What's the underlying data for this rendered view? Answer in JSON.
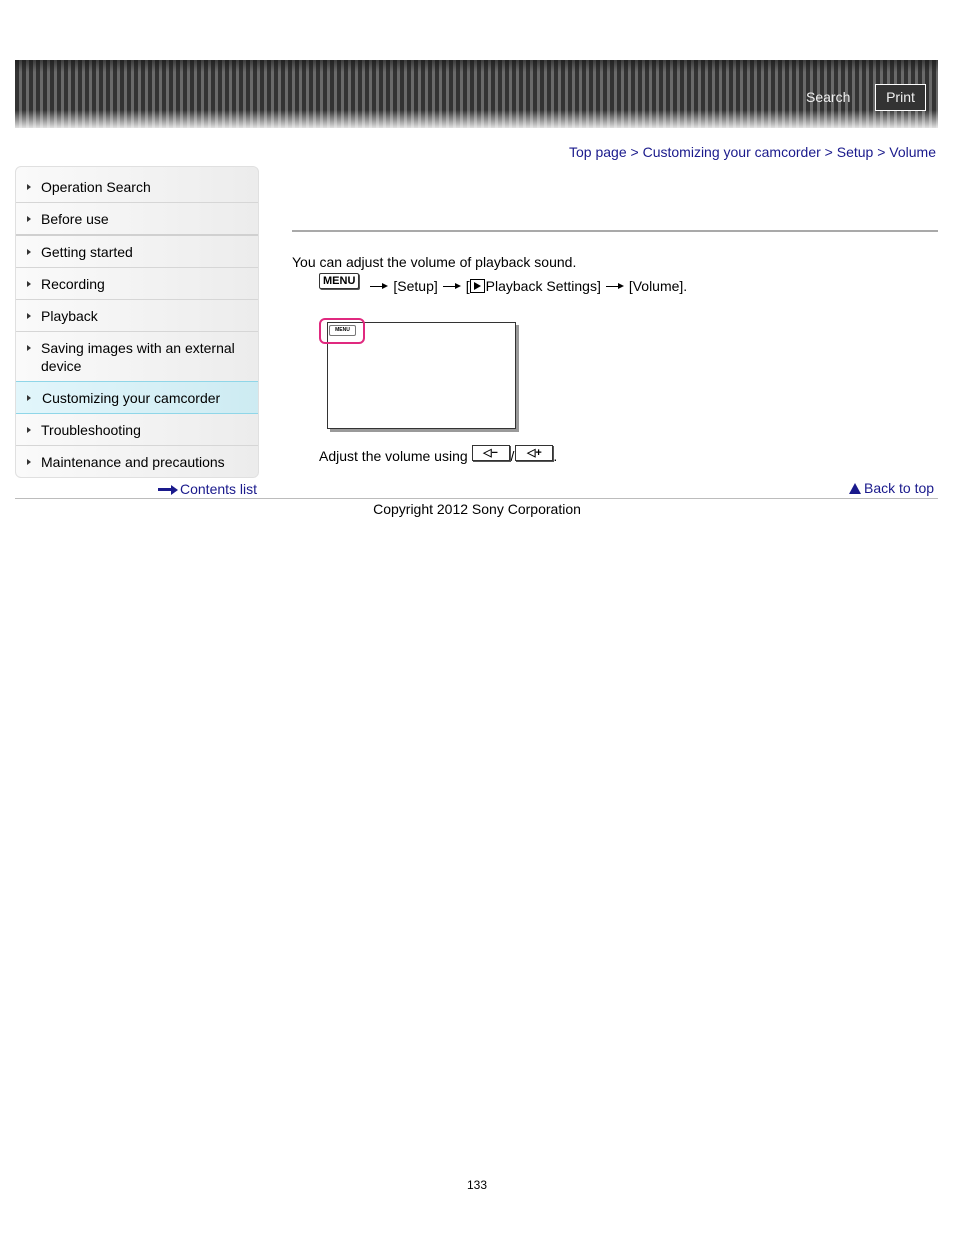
{
  "header": {
    "search_label": "Search",
    "print_label": "Print"
  },
  "breadcrumb": {
    "items": [
      "Top page",
      "Customizing your camcorder",
      "Setup",
      "Volume"
    ],
    "separator": ">"
  },
  "sidebar": {
    "items": [
      {
        "label": "Operation Search",
        "active": false
      },
      {
        "label": "Before use",
        "active": false
      },
      {
        "label": "Getting started",
        "active": false
      },
      {
        "label": "Recording",
        "active": false
      },
      {
        "label": "Playback",
        "active": false
      },
      {
        "label": "Saving images with an external device",
        "active": false
      },
      {
        "label": "Customizing your camcorder",
        "active": true
      },
      {
        "label": "Troubleshooting",
        "active": false
      },
      {
        "label": "Maintenance and precautions",
        "active": false
      }
    ],
    "contents_link": "Contents list"
  },
  "main": {
    "intro": "You can adjust the volume of playback sound.",
    "steps": {
      "menu_key": "MENU",
      "step1": "[Setup]",
      "step2_open": "[",
      "step2_label": "Playback Settings]",
      "step3": "[Volume]."
    },
    "screen_menu_label": "MENU",
    "adjust_text": "Adjust the volume using",
    "vol_down_key": "◁−",
    "vol_up_key": "◁+",
    "slash": "/",
    "period": "."
  },
  "footer": {
    "back_to_top": "Back to top",
    "copyright": "Copyright 2012 Sony Corporation",
    "page_number": "133"
  },
  "colors": {
    "link": "#1a1a8c",
    "highlight": "#e0297f",
    "active_nav": "#d6f0f6"
  }
}
